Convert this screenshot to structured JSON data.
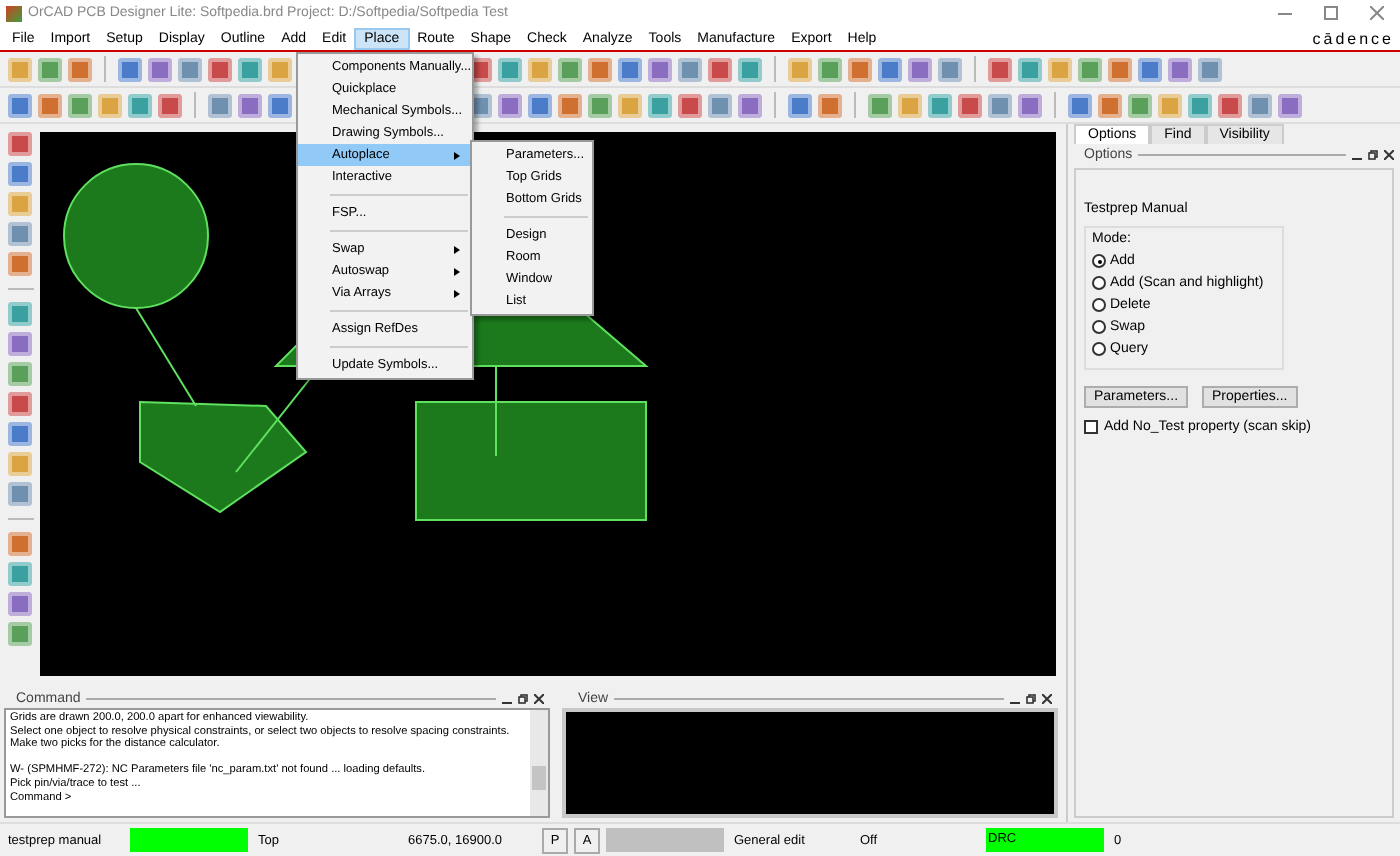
{
  "window": {
    "title": "OrCAD PCB Designer Lite: Softpedia.brd  Project: D:/Softpedia/Softpedia Test",
    "logo": "cādence"
  },
  "menu": [
    {
      "label": "File",
      "selected": false
    },
    {
      "label": "Import",
      "selected": false
    },
    {
      "label": "Setup",
      "selected": false
    },
    {
      "label": "Display",
      "selected": false
    },
    {
      "label": "Outline",
      "selected": false
    },
    {
      "label": "Add",
      "selected": false
    },
    {
      "label": "Edit",
      "selected": false
    },
    {
      "label": "Place",
      "selected": true
    },
    {
      "label": "Route",
      "selected": false
    },
    {
      "label": "Shape",
      "selected": false
    },
    {
      "label": "Check",
      "selected": false
    },
    {
      "label": "Analyze",
      "selected": false
    },
    {
      "label": "Tools",
      "selected": false
    },
    {
      "label": "Manufacture",
      "selected": false
    },
    {
      "label": "Export",
      "selected": false
    },
    {
      "label": "Help",
      "selected": false
    }
  ],
  "place_menu": [
    {
      "label": "Components Manually...",
      "submenu": false,
      "selected": false,
      "separator_before": false
    },
    {
      "label": "Quickplace",
      "submenu": false,
      "selected": false,
      "separator_before": false
    },
    {
      "label": "Mechanical Symbols...",
      "submenu": false,
      "selected": false,
      "separator_before": false
    },
    {
      "label": "Drawing Symbols...",
      "submenu": false,
      "selected": false,
      "separator_before": false
    },
    {
      "label": "Autoplace",
      "submenu": true,
      "selected": true,
      "separator_before": false
    },
    {
      "label": "Interactive",
      "submenu": false,
      "selected": false,
      "separator_before": false
    },
    {
      "label": "FSP...",
      "submenu": false,
      "selected": false,
      "separator_before": true
    },
    {
      "label": "Swap",
      "submenu": true,
      "selected": false,
      "separator_before": true
    },
    {
      "label": "Autoswap",
      "submenu": true,
      "selected": false,
      "separator_before": false
    },
    {
      "label": "Via Arrays",
      "submenu": true,
      "selected": false,
      "separator_before": false
    },
    {
      "label": "Assign RefDes",
      "submenu": false,
      "selected": false,
      "separator_before": true
    },
    {
      "label": "Update Symbols...",
      "submenu": false,
      "selected": false,
      "separator_before": true
    }
  ],
  "autoplace_menu": [
    {
      "label": "Parameters...",
      "separator_before": false
    },
    {
      "label": "Top Grids",
      "separator_before": false
    },
    {
      "label": "Bottom Grids",
      "separator_before": false
    },
    {
      "label": "Design",
      "separator_before": true
    },
    {
      "label": "Room",
      "separator_before": false
    },
    {
      "label": "Window",
      "separator_before": false
    },
    {
      "label": "List",
      "separator_before": false
    }
  ],
  "panel": {
    "tabs": [
      {
        "label": "Options",
        "selected": true
      },
      {
        "label": "Find",
        "selected": false
      },
      {
        "label": "Visibility",
        "selected": false
      }
    ],
    "title": "Options",
    "section": "Testprep Manual",
    "mode_label": "Mode:",
    "modes": [
      {
        "label": "Add",
        "selected": true
      },
      {
        "label": "Add (Scan and highlight)",
        "selected": false
      },
      {
        "label": "Delete",
        "selected": false
      },
      {
        "label": "Swap",
        "selected": false
      },
      {
        "label": "Query",
        "selected": false
      }
    ],
    "buttons": [
      "Parameters...",
      "Properties..."
    ],
    "checkbox": {
      "label": "Add No_Test property (scan skip)",
      "checked": false
    }
  },
  "command": {
    "title": "Command",
    "lines": [
      {
        "text": "Grids are drawn 200.0, 200.0 apart for enhanced viewability.",
        "gap_before": false
      },
      {
        "text": "Select one object to resolve physical constraints, or select two objects to resolve spacing constraints.",
        "gap_before": false
      },
      {
        "text": "Make two picks for the distance calculator.",
        "gap_before": false
      },
      {
        "text": "W- (SPMHMF-272): NC Parameters file 'nc_param.txt' not found ... loading defaults.",
        "gap_before": true
      },
      {
        "text": "Pick pin/via/trace to test ...",
        "gap_before": false
      },
      {
        "text": "Command >",
        "gap_before": false
      }
    ]
  },
  "view": {
    "title": "View"
  },
  "status_bar": [
    {
      "kind": "text",
      "text": "testprep manual"
    },
    {
      "kind": "indicator",
      "color": "#00ff00"
    },
    {
      "kind": "text",
      "text": "Top"
    },
    {
      "kind": "text",
      "text": "6675.0, 16900.0"
    },
    {
      "kind": "button",
      "text": "P"
    },
    {
      "kind": "button",
      "text": "A"
    },
    {
      "kind": "indicator",
      "color": "#c0c0c0"
    },
    {
      "kind": "text",
      "text": "General edit"
    },
    {
      "kind": "text",
      "text": "Off"
    },
    {
      "kind": "indicator",
      "color": "#00ff00",
      "text": "DRC"
    },
    {
      "kind": "text",
      "text": "0"
    }
  ]
}
